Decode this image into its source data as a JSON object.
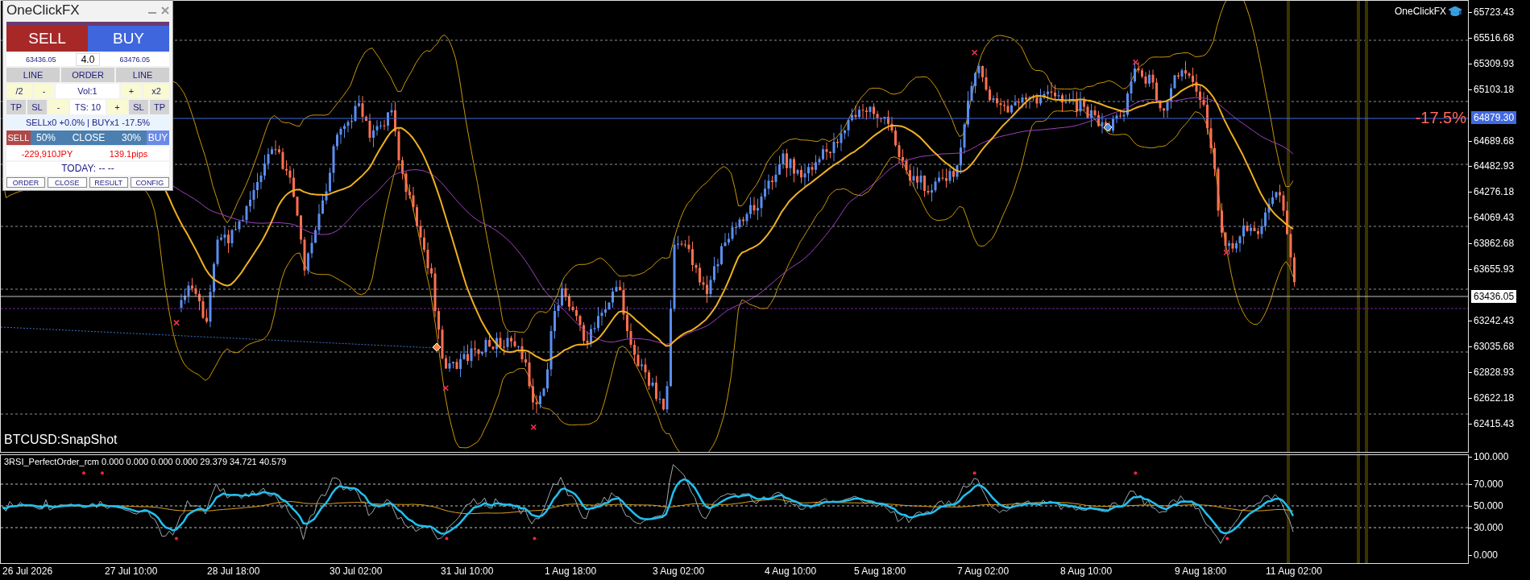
{
  "panel": {
    "title": "OneClickFX",
    "sell_button": "SELL",
    "buy_button": "BUY",
    "spread": "4.0",
    "sell_price": "63436.05",
    "buy_price": "63476.05",
    "line_row": [
      "LINE",
      "ORDER",
      "LINE"
    ],
    "volume_row": [
      {
        "label": "/2",
        "kind": "step"
      },
      {
        "label": "-",
        "kind": "step"
      },
      {
        "label": "Vol:1",
        "kind": "field"
      },
      {
        "label": "+",
        "kind": "step"
      },
      {
        "label": "x2",
        "kind": "step"
      }
    ],
    "stop_row": [
      {
        "label": "TP",
        "kind": "target"
      },
      {
        "label": "SL",
        "kind": "target"
      },
      {
        "label": "-",
        "kind": "step"
      },
      {
        "label": "TS: 10",
        "kind": "field"
      },
      {
        "label": "+",
        "kind": "step"
      },
      {
        "label": "SL",
        "kind": "target"
      },
      {
        "label": "TP",
        "kind": "target"
      }
    ],
    "position_summary": "SELLx0 +0.0% | BUYx1 -17.5%",
    "close_row": [
      {
        "label": "SELL",
        "kind": "sell"
      },
      {
        "label": "50%",
        "kind": "partial"
      },
      {
        "label": "CLOSE",
        "kind": "close"
      },
      {
        "label": "30%",
        "kind": "partial"
      },
      {
        "label": "BUY",
        "kind": "buy"
      }
    ],
    "profit": "-229,910JPY",
    "pips": "139.1pips",
    "today": "TODAY: -- --",
    "footer_buttons": [
      "ORDER",
      "CLOSE",
      "RESULT",
      "CONFIG"
    ]
  },
  "chart": {
    "brand": "OneClickFX",
    "symbol_label": "BTCUSD:SnapShot",
    "percent_label": "-17.5%",
    "price_ticks": [
      "65723.43",
      "65516.68",
      "65309.93",
      "65103.18",
      "64689.68",
      "64482.93",
      "64276.18",
      "64069.43",
      "63862.68",
      "63655.93",
      "63242.43",
      "63035.68",
      "62828.93",
      "62622.18",
      "62415.43"
    ],
    "line_price_tag": "64879.30",
    "current_price_tag": "63436.05"
  },
  "indicator": {
    "title": "3RSI_PerfectOrder_rcm 0.000 0.000 0.000 0.000 29.379 34.721 40.579",
    "ticks": [
      "100.000",
      "70.000",
      "50.000",
      "30.000",
      "0.000"
    ]
  },
  "time_axis": [
    "26 Jul 2026",
    "27 Jul 10:00",
    "28 Jul 18:00",
    "30 Jul 02:00",
    "31 Jul 10:00",
    "1 Aug 18:00",
    "3 Aug 02:00",
    "4 Aug 10:00",
    "5 Aug 18:00",
    "7 Aug 02:00",
    "8 Aug 10:00",
    "9 Aug 18:00",
    "11 Aug 02:00"
  ]
}
